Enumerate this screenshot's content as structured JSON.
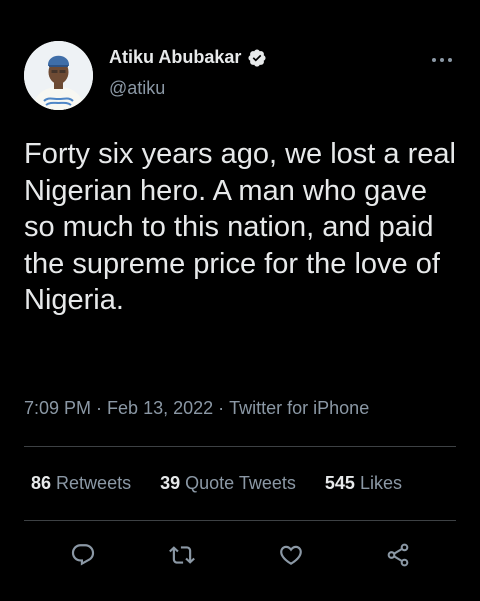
{
  "author": {
    "display_name": "Atiku Abubakar",
    "handle": "@atiku",
    "verified": true,
    "avatar_icon": "profile-photo"
  },
  "tweet": {
    "text": "Forty six years ago, we lost a real Nigerian hero. A man who gave so much to this nation, and paid the supreme price for the love of Nigeria.",
    "time": "7:09 PM",
    "separator": "·",
    "date": "Feb 13, 2022",
    "source": "Twitter for iPhone"
  },
  "stats": {
    "retweets_count": "86",
    "retweets_label": "Retweets",
    "quote_count": "39",
    "quote_label": "Quote Tweets",
    "likes_count": "545",
    "likes_label": "Likes"
  },
  "actions": [
    {
      "icon": "reply-icon"
    },
    {
      "icon": "retweet-icon"
    },
    {
      "icon": "like-icon"
    },
    {
      "icon": "share-icon"
    }
  ],
  "colors": {
    "background": "#000000",
    "primary_text": "#e7e9ea",
    "secondary_text": "#8b98a5",
    "divider": "#3d4144",
    "icon": "#8b98a5"
  }
}
